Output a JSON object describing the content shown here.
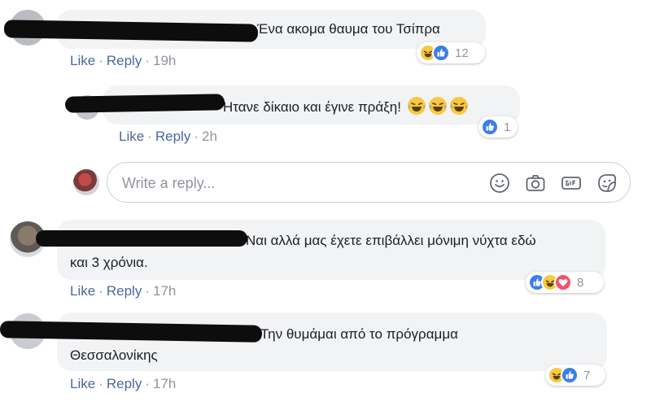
{
  "colors": {
    "link": "#4b67a1",
    "meta": "#90949c",
    "bubble": "#f2f3f5",
    "like": "#3b7ee8",
    "haha": "#f7c842",
    "love": "#f25268"
  },
  "comments": [
    {
      "text": "Ένα ακομα θαυμα του Τσίπρα",
      "actions": {
        "like": "Like",
        "reply": "Reply",
        "sep": "·",
        "time": "19h"
      },
      "reactions": {
        "icons": [
          "haha-icon",
          "like-icon"
        ],
        "count": "12"
      }
    },
    {
      "text": "Ήτανε δίκαιο και έγινε πράξη!",
      "emojis": [
        "tears-of-joy-emoji",
        "tears-of-joy-emoji",
        "tears-of-joy-emoji"
      ],
      "actions": {
        "like": "Like",
        "reply": "Reply",
        "sep": "·",
        "time": "2h"
      },
      "reactions": {
        "icons": [
          "like-icon"
        ],
        "count": "1"
      }
    },
    {
      "text_line1": "Ναι αλλά μας έχετε επιβάλλει μόνιμη νύχτα εδώ",
      "text_line2": "και 3 χρόνια.",
      "actions": {
        "like": "Like",
        "reply": "Reply",
        "sep": "·",
        "time": "17h"
      },
      "reactions": {
        "icons": [
          "like-icon",
          "haha-icon",
          "love-icon"
        ],
        "count": "8"
      }
    },
    {
      "text_line1": "Την θυμάμαι από το πρόγραμμα",
      "text_line2": "Θεσσαλονίκης",
      "actions": {
        "like": "Like",
        "reply": "Reply",
        "sep": "·",
        "time": "17h"
      },
      "reactions": {
        "icons": [
          "haha-icon",
          "like-icon"
        ],
        "count": "7"
      }
    }
  ],
  "reply_box": {
    "placeholder": "Write a reply...",
    "tools": [
      "smiley-icon",
      "camera-icon",
      "gif-icon",
      "sticker-icon"
    ]
  }
}
